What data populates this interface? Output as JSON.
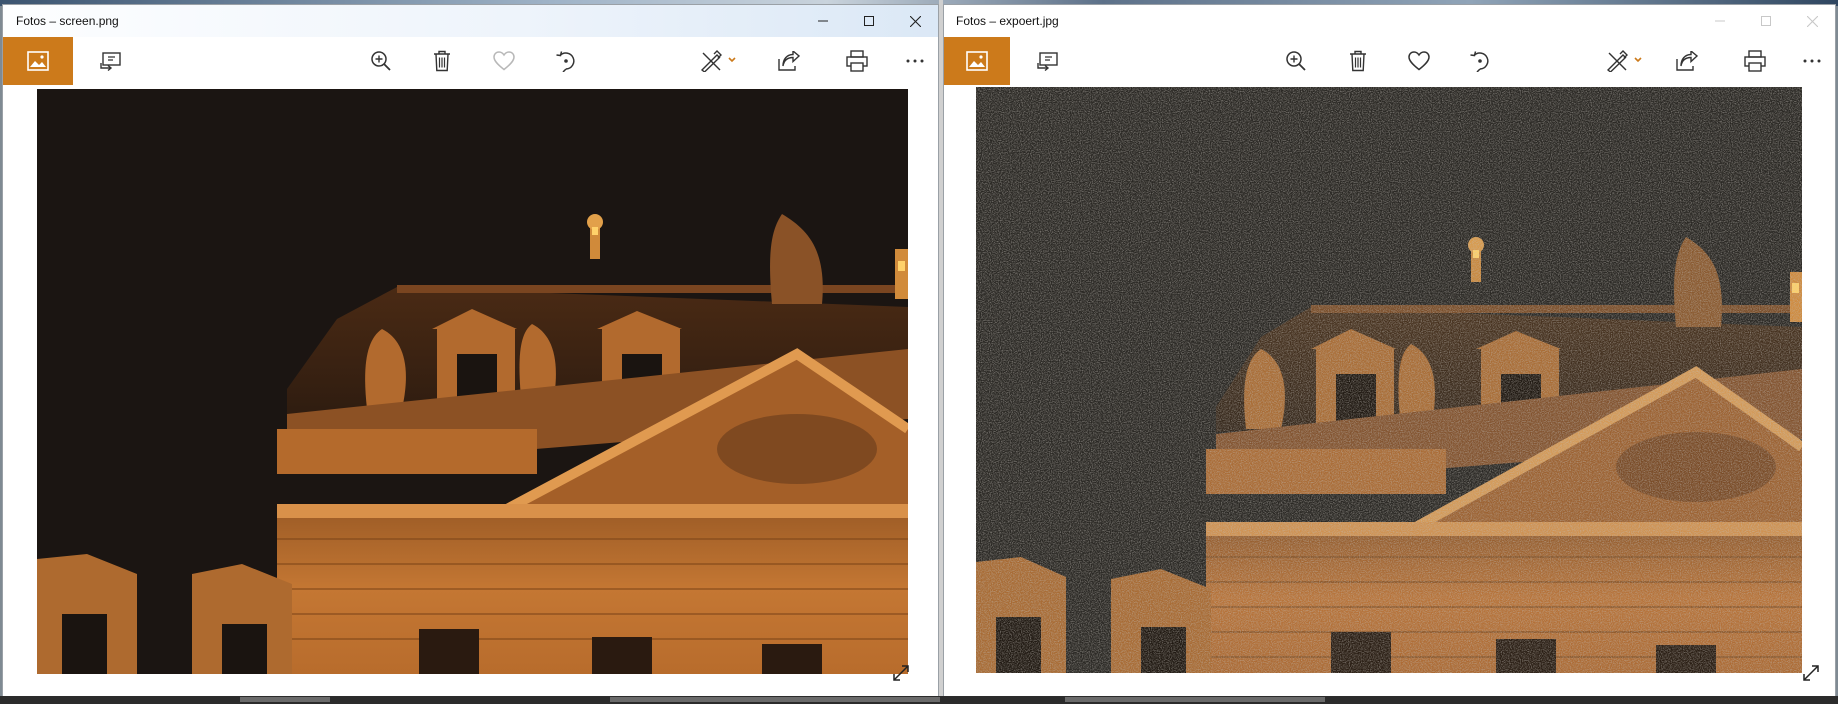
{
  "windows": [
    {
      "id": "left",
      "title": "Fotos – screen.png",
      "caption_buttons": [
        "minimize",
        "maximize",
        "close"
      ],
      "toolbar": {
        "view_button_active": true,
        "favorite_enabled": false,
        "icons": [
          "photo-view-icon",
          "slideshow-icon",
          "zoom-in-icon",
          "delete-icon",
          "favorite-icon",
          "rotate-icon",
          "edit-create-icon",
          "share-icon",
          "print-icon",
          "more-icon"
        ]
      },
      "photo": {
        "description": "",
        "style": "clean"
      }
    },
    {
      "id": "right",
      "title": "Fotos – expoert.jpg",
      "caption_buttons": [
        "minimize",
        "maximize",
        "close"
      ],
      "toolbar": {
        "view_button_active": true,
        "favorite_enabled": true,
        "icons": [
          "photo-view-icon",
          "slideshow-icon",
          "zoom-in-icon",
          "delete-icon",
          "favorite-icon",
          "rotate-icon",
          "edit-create-icon",
          "share-icon",
          "print-icon",
          "more-icon"
        ]
      },
      "photo": {
        "description": "",
        "style": "noisy"
      }
    }
  ],
  "colors": {
    "accent": "#cc7a1b",
    "facade": "#b5682b",
    "facade_light": "#d98c46",
    "facade_dark": "#6a3b18",
    "sky_left": "#1b1512",
    "sky_right": "#2a2824",
    "window_dark": "#1a1410",
    "lamp": "#ffc85a"
  }
}
